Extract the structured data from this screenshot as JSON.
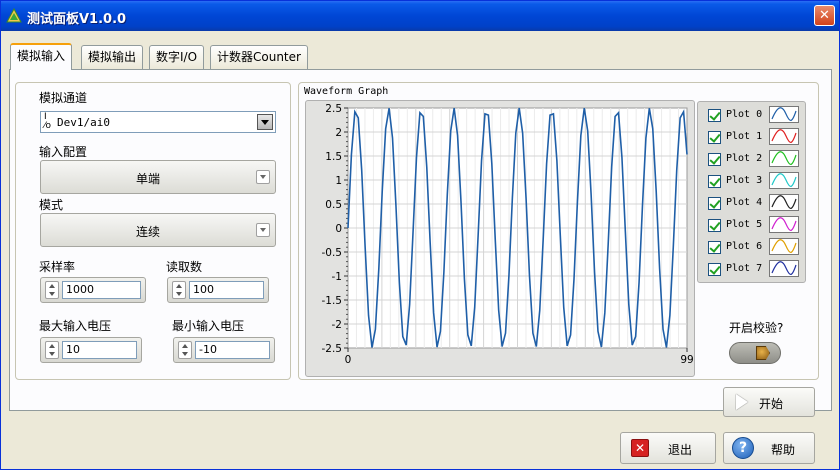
{
  "window": {
    "title": "测试面板V1.0.0",
    "close_glyph": "✕"
  },
  "tabs": [
    {
      "label": "模拟输入",
      "active": true
    },
    {
      "label": "模拟输出"
    },
    {
      "label": "数字I/O"
    },
    {
      "label": "计数器Counter"
    }
  ],
  "settings": {
    "channel": {
      "label": "模拟通道",
      "prefix_top": "I",
      "prefix_bottom": "⁄o",
      "value": "Dev1/ai0"
    },
    "input_config": {
      "label": "输入配置",
      "value": "单端"
    },
    "mode": {
      "label": "模式",
      "value": "连续"
    },
    "sample_rate": {
      "label": "采样率",
      "value": "1000"
    },
    "read_count": {
      "label": "读取数",
      "value": "100"
    },
    "max_voltage": {
      "label": "最大输入电压",
      "value": "10"
    },
    "min_voltage": {
      "label": "最小输入电压",
      "value": "-10"
    }
  },
  "graph": {
    "title": "Waveform Graph",
    "legend": [
      {
        "name": "Plot 0",
        "color": "#1f5fa8"
      },
      {
        "name": "Plot 1",
        "color": "#e02020"
      },
      {
        "name": "Plot 2",
        "color": "#20c020"
      },
      {
        "name": "Plot 3",
        "color": "#20c8c8"
      },
      {
        "name": "Plot 4",
        "color": "#202020"
      },
      {
        "name": "Plot 5",
        "color": "#d020d0"
      },
      {
        "name": "Plot 6",
        "color": "#e0a000"
      },
      {
        "name": "Plot 7",
        "color": "#2030a0"
      }
    ]
  },
  "chart_data": {
    "type": "line",
    "title": "Waveform Graph",
    "xlabel": "",
    "ylabel": "",
    "xlim": [
      0,
      99
    ],
    "ylim": [
      -2.5,
      2.5
    ],
    "x_ticks": [
      "0",
      "99"
    ],
    "y_ticks": [
      "2.5",
      "2",
      "1.5",
      "1",
      "0.5",
      "0",
      "-0.5",
      "-1",
      "-1.5",
      "-2",
      "-2.5"
    ],
    "grid": true,
    "legend_position": "right",
    "series": [
      {
        "name": "Plot 0",
        "color": "#1f5fa8",
        "amplitude": 2.5,
        "cycles": 10.5,
        "samples": 100
      }
    ]
  },
  "calibration": {
    "label": "开启校验?"
  },
  "buttons": {
    "start": "开始",
    "exit": "退出",
    "exit_glyph": "✕",
    "help": "帮助",
    "help_glyph": "?"
  }
}
